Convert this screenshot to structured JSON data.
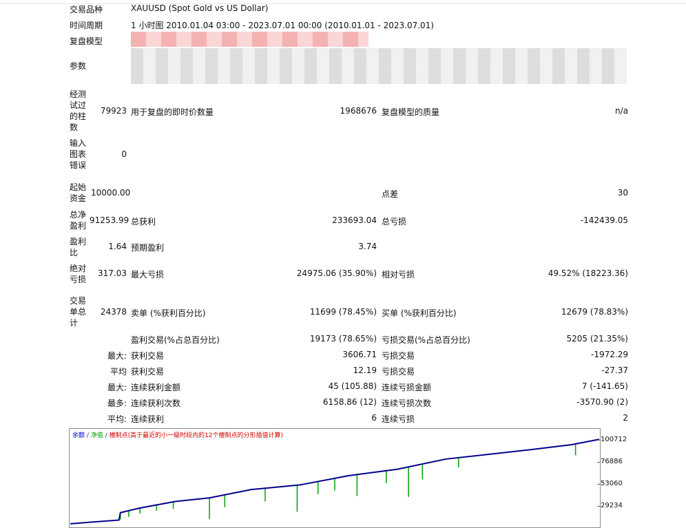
{
  "header": {
    "symbol_label": "交易品种",
    "symbol_value": "XAUUSD (Spot Gold vs US Dollar)",
    "period_label": "时间周期",
    "period_value": "1 小时图 2010.01.04 03:00 - 2023.07.01 00:00 (2010.01.01 - 2023.07.01)",
    "model_label": "复盘模型",
    "params_label": "参数"
  },
  "stats": {
    "bars_label": "经测试过的柱数",
    "bars_value": "79923",
    "ticks_label": "用于复盘的即时价数量",
    "ticks_value": "1968676",
    "quality_label": "复盘模型的质量",
    "quality_value": "n/a",
    "errors_label": "输入图表错误",
    "errors_value": "0",
    "deposit_label": "起始资金",
    "deposit_value": "10000.00",
    "spread_label": "点差",
    "spread_value": "30",
    "net_label": "总净盈利",
    "net_value": "91253.99",
    "gross_profit_label": "总获利",
    "gross_profit_value": "233693.04",
    "gross_loss_label": "总亏损",
    "gross_loss_value": "-142439.05",
    "pf_label": "盈利比",
    "pf_value": "1.64",
    "expected_label": "预期盈利",
    "expected_value": "3.74",
    "abs_dd_label": "绝对亏损",
    "abs_dd_value": "317.03",
    "max_dd_label": "最大亏损",
    "max_dd_value": "24975.06 (35.90%)",
    "rel_dd_label": "相对亏损",
    "rel_dd_value": "49.52% (18223.36)",
    "total_trades_label": "交易单总计",
    "total_trades_value": "24378",
    "short_label": "卖单 (%获利百分比)",
    "short_value": "11699 (78.45%)",
    "long_label": "买单 (%获利百分比)",
    "long_value": "12679 (78.83%)",
    "profit_trades_label": "盈利交易(%占总百分比)",
    "profit_trades_value": "19173 (78.65%)",
    "loss_trades_label": "亏损交易(%占总百分比)",
    "loss_trades_value": "5205 (21.35%)",
    "largest_label": "最大:",
    "largest_profit_label": "获利交易",
    "largest_profit_value": "3606.71",
    "largest_loss_label": "亏损交易",
    "largest_loss_value": "-1972.29",
    "average_label": "平均",
    "avg_profit_label": "获利交易",
    "avg_profit_value": "12.19",
    "avg_loss_label": "亏损交易",
    "avg_loss_value": "-27.37",
    "max_cons_label": "最大:",
    "max_cons_wins_label": "连续获利金额",
    "max_cons_wins_value": "45 (105.88)",
    "max_cons_losses_label": "连续亏损金额",
    "max_cons_losses_value": "7 (-141.65)",
    "maximal_label": "最多:",
    "maximal_profit_label": "连续获利次数",
    "maximal_profit_value": "6158.86 (12)",
    "maximal_loss_label": "连续亏损次数",
    "maximal_loss_value": "-3570.90 (2)",
    "avg_cons_label": "平均:",
    "avg_cons_wins_label": "连续获利",
    "avg_cons_wins_value": "6",
    "avg_cons_losses_label": "连续亏损",
    "avg_cons_losses_value": "2"
  },
  "chart_data": {
    "type": "line",
    "legend": {
      "balance": "余额",
      "separator": " / ",
      "equity": "净值",
      "note": "檀制点(高于最近的小一級时段内的12个檀制点的分形插值计算)"
    },
    "y_ticks": [
      100712,
      76886,
      53060,
      29234
    ],
    "colors": {
      "balance": "#00008b",
      "equity": "#00a000",
      "note": "#d00000"
    },
    "series": [
      {
        "name": "余额",
        "x": [
          0,
          70,
          72,
          100,
          150,
          200,
          260,
          330,
          400,
          470,
          540,
          600,
          660,
          720,
          760
        ],
        "y": [
          10000,
          14000,
          22000,
          27000,
          34000,
          38000,
          47000,
          52000,
          62000,
          69000,
          80000,
          85000,
          90000,
          95500,
          101300
        ]
      }
    ],
    "equity_dips": [
      {
        "x": 72,
        "y": 14500
      },
      {
        "x": 84,
        "y": 17500
      },
      {
        "x": 100,
        "y": 21000
      },
      {
        "x": 124,
        "y": 24000
      },
      {
        "x": 148,
        "y": 26000
      },
      {
        "x": 200,
        "y": 15000
      },
      {
        "x": 222,
        "y": 28000
      },
      {
        "x": 280,
        "y": 34000
      },
      {
        "x": 326,
        "y": 23000
      },
      {
        "x": 356,
        "y": 42000
      },
      {
        "x": 380,
        "y": 46000
      },
      {
        "x": 412,
        "y": 40000
      },
      {
        "x": 454,
        "y": 54000
      },
      {
        "x": 486,
        "y": 39000
      },
      {
        "x": 506,
        "y": 58000
      },
      {
        "x": 558,
        "y": 71000
      },
      {
        "x": 726,
        "y": 84000
      }
    ]
  }
}
